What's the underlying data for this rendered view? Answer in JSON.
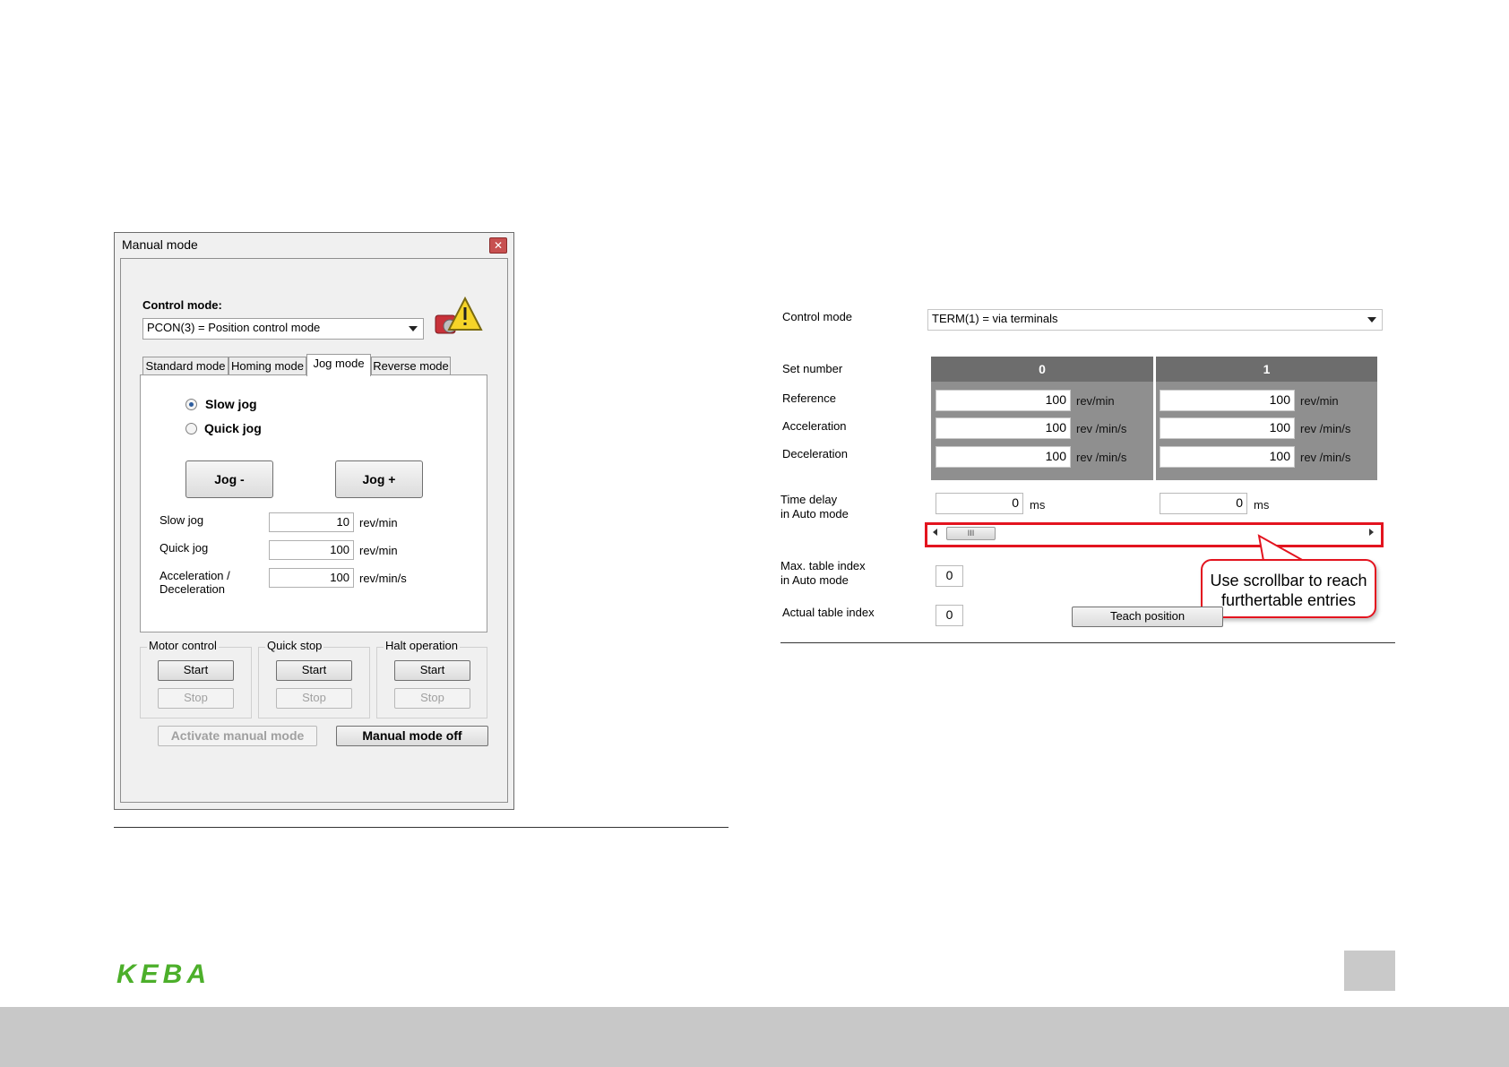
{
  "dialog": {
    "title": "Manual mode",
    "close_glyph": "✕",
    "control_mode_label": "Control mode:",
    "control_mode_value": "PCON(3) = Position control mode",
    "tabs": [
      {
        "label": "Standard mode",
        "active": false
      },
      {
        "label": "Homing mode",
        "active": false
      },
      {
        "label": "Jog mode",
        "active": true
      },
      {
        "label": "Reverse mode",
        "active": false
      }
    ],
    "radios": [
      {
        "label": "Slow jog",
        "selected": true
      },
      {
        "label": "Quick jog",
        "selected": false
      }
    ],
    "jog_minus_label": "Jog -",
    "jog_plus_label": "Jog +",
    "params": [
      {
        "label": "Slow jog",
        "value": "10",
        "unit": "rev/min"
      },
      {
        "label": "Quick jog",
        "value": "100",
        "unit": "rev/min"
      },
      {
        "label_line1": "Acceleration /",
        "label_line2": "Deceleration",
        "value": "100",
        "unit": "rev/min/s"
      }
    ],
    "groups": [
      {
        "title": "Motor control",
        "start": "Start",
        "stop": "Stop"
      },
      {
        "title": "Quick stop",
        "start": "Start",
        "stop": "Stop"
      },
      {
        "title": "Halt operation",
        "start": "Start",
        "stop": "Stop"
      }
    ],
    "activate_label": "Activate manual mode",
    "manual_off_label": "Manual mode off"
  },
  "table_panel": {
    "control_mode_label": "Control mode",
    "control_mode_value": "TERM(1) = via terminals",
    "set_number_label": "Set number",
    "row_labels": [
      "Reference",
      "Acceleration",
      "Deceleration"
    ],
    "sets": [
      {
        "number": "0",
        "reference": "100",
        "acceleration": "100",
        "deceleration": "100",
        "time_delay": "0"
      },
      {
        "number": "1",
        "reference": "100",
        "acceleration": "100",
        "deceleration": "100",
        "time_delay": "0"
      }
    ],
    "units": {
      "reference": "rev/min",
      "acceleration": "rev /min/s",
      "deceleration": "rev /min/s",
      "time": "ms"
    },
    "time_delay_line1": "Time delay",
    "time_delay_line2": "in Auto mode",
    "scroll_thumb_glyph": "III",
    "max_index_line1": "Max. table index",
    "max_index_line2": "in Auto mode",
    "max_index_value": "0",
    "actual_index_label": "Actual table index",
    "actual_index_value": "0",
    "teach_label": "Teach position",
    "callout_line1": "Use scrollbar to reach",
    "callout_line2": "furthertable entries"
  },
  "footer": {
    "logo_text": "KEBA"
  },
  "colors": {
    "highlight_red": "#e3141f",
    "logo_green": "#4caf2a",
    "set_header": "#6d6d6d",
    "set_body": "#8f8f8f"
  }
}
